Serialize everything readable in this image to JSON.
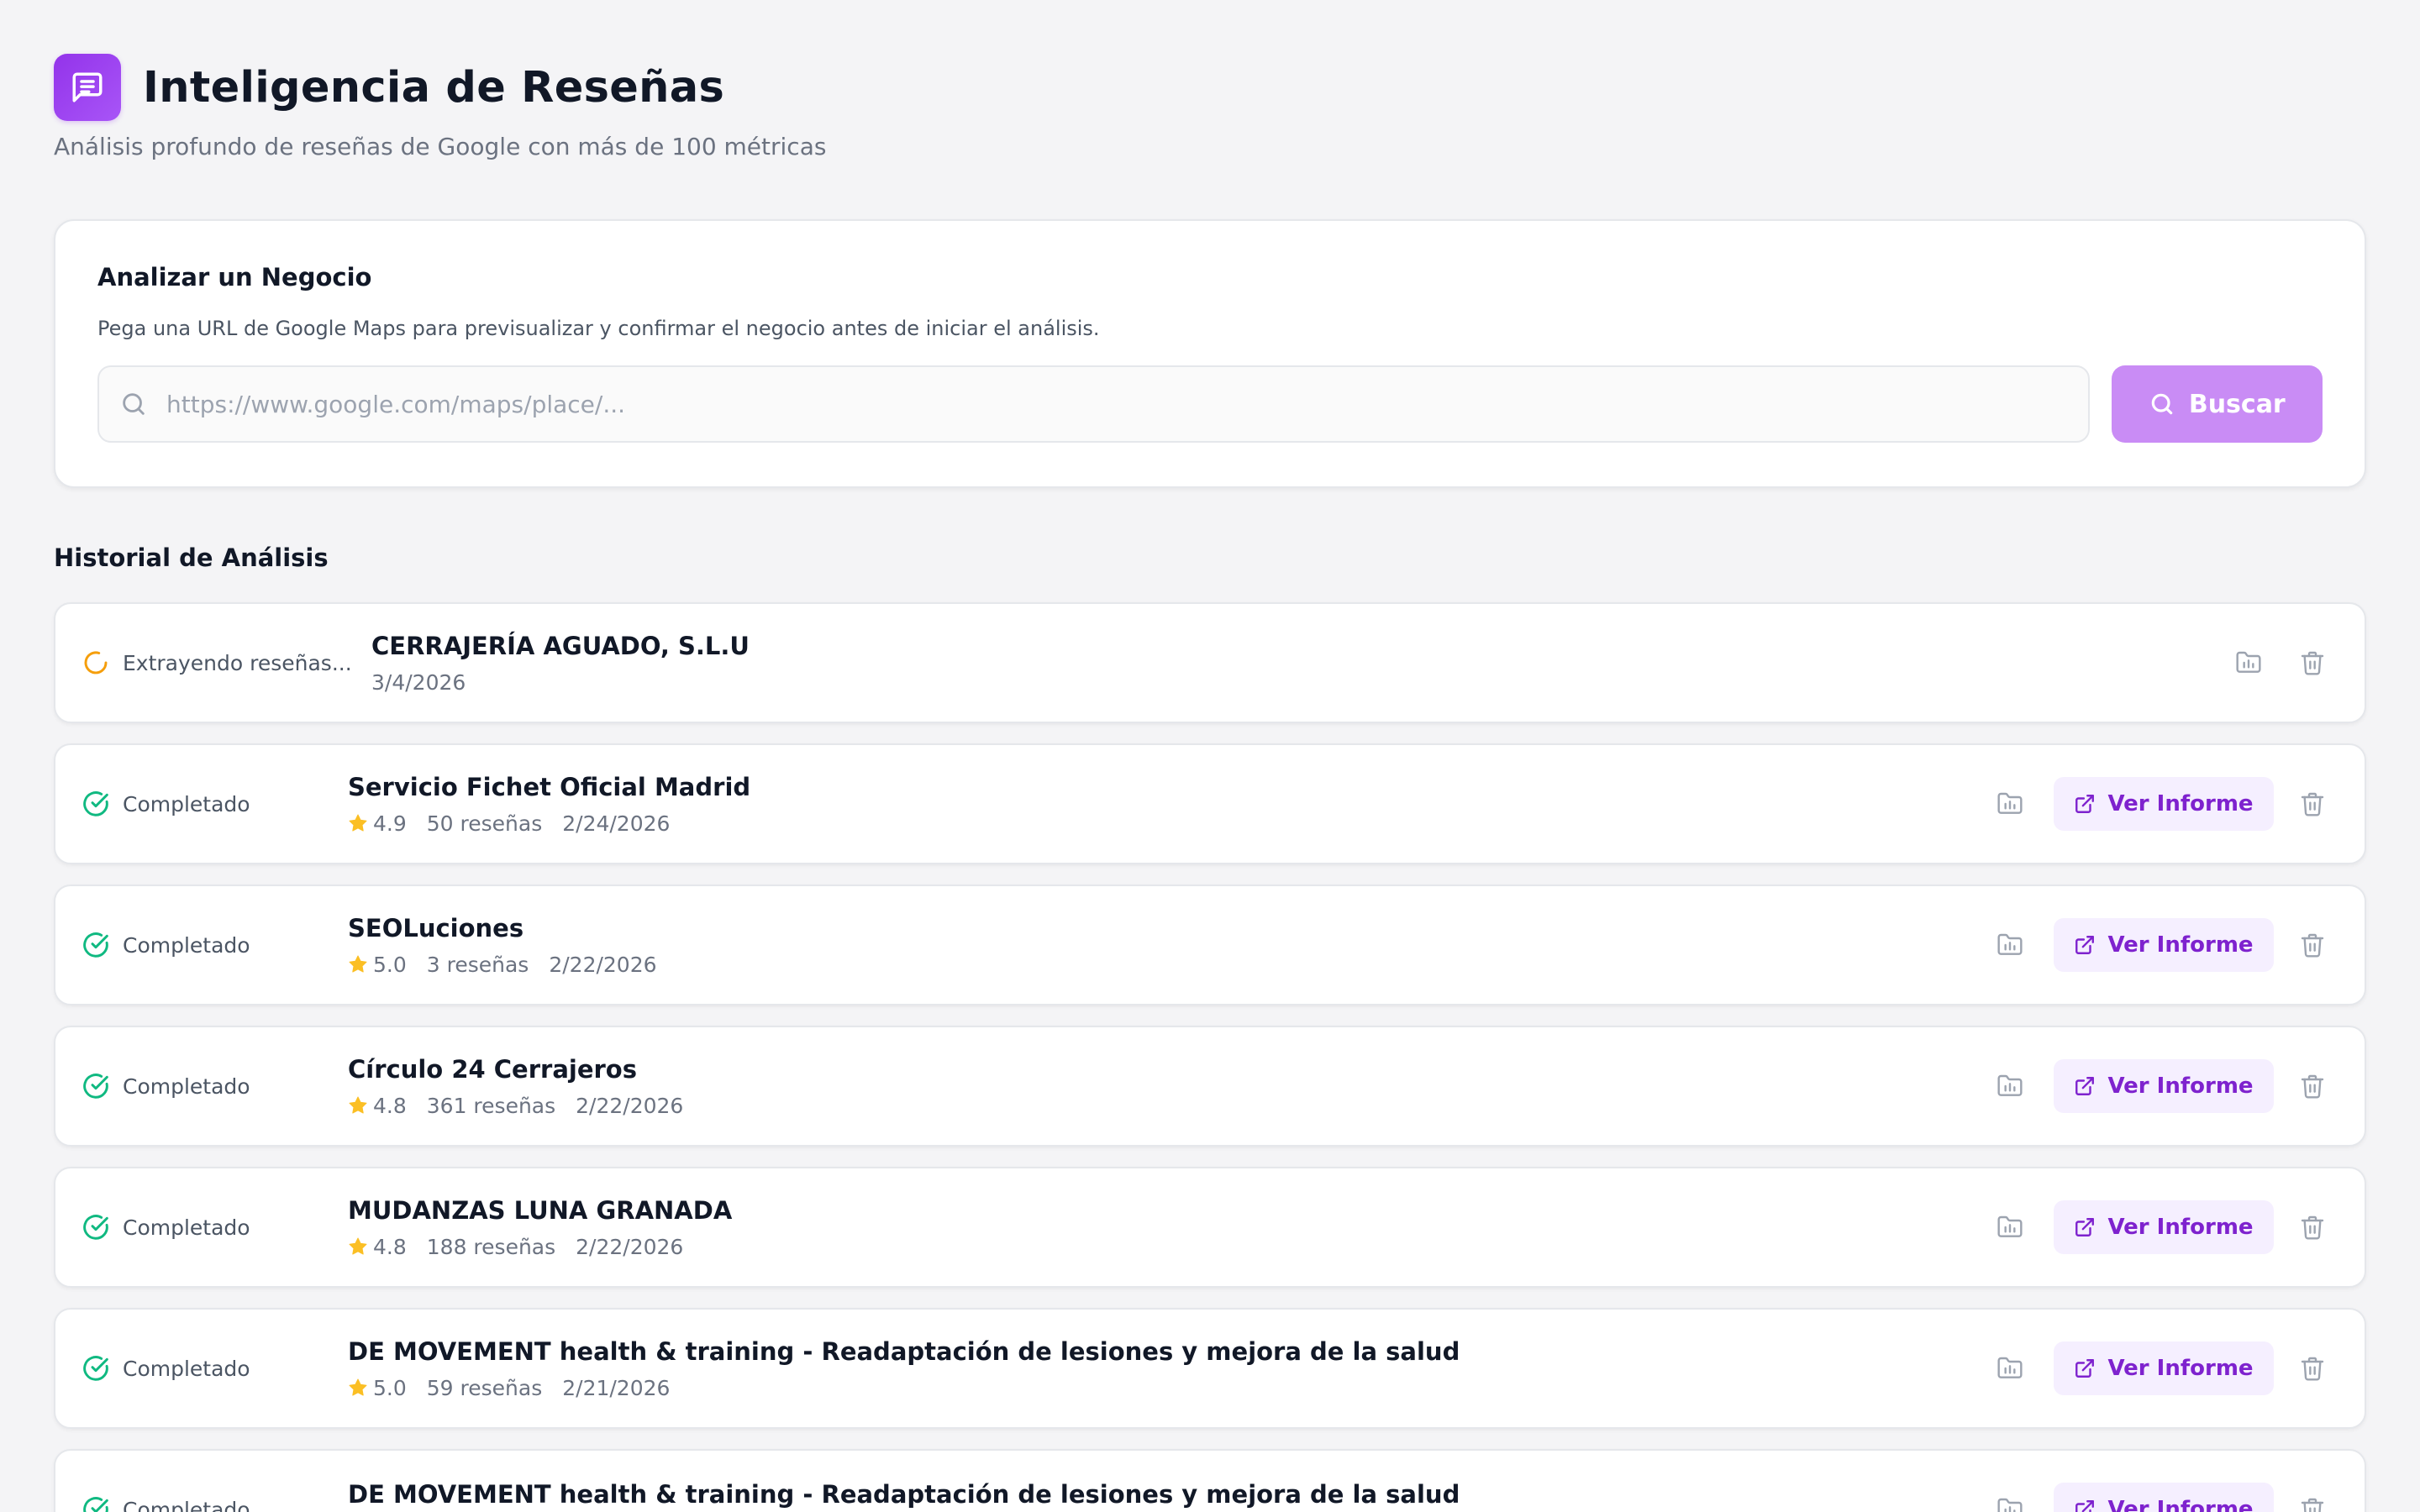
{
  "header": {
    "title": "Inteligencia de Reseñas",
    "subtitle": "Análisis profundo de reseñas de Google con más de 100 métricas"
  },
  "analyze": {
    "title": "Analizar un Negocio",
    "description": "Pega una URL de Google Maps para previsualizar y confirmar el negocio antes de iniciar el análisis.",
    "input_value": "",
    "placeholder": "https://www.google.com/maps/place/...",
    "search_label": "Buscar"
  },
  "history": {
    "title": "Historial de Análisis",
    "report_label": "Ver Informe",
    "items": [
      {
        "status": "extracting",
        "status_label": "Extrayendo reseñas...",
        "name": "CERRAJERÍA AGUADO, S.L.U",
        "date": "3/4/2026"
      },
      {
        "status": "completed",
        "status_label": "Completado",
        "name": "Servicio Fichet Oficial Madrid",
        "rating": "4.9",
        "reviews": "50 reseñas",
        "date": "2/24/2026"
      },
      {
        "status": "completed",
        "status_label": "Completado",
        "name": "SEOLuciones",
        "rating": "5.0",
        "reviews": "3 reseñas",
        "date": "2/22/2026"
      },
      {
        "status": "completed",
        "status_label": "Completado",
        "name": "Círculo 24 Cerrajeros",
        "rating": "4.8",
        "reviews": "361 reseñas",
        "date": "2/22/2026"
      },
      {
        "status": "completed",
        "status_label": "Completado",
        "name": "MUDANZAS LUNA GRANADA",
        "rating": "4.8",
        "reviews": "188 reseñas",
        "date": "2/22/2026"
      },
      {
        "status": "completed",
        "status_label": "Completado",
        "name": "DE MOVEMENT health & training - Readaptación de lesiones y mejora de la salud",
        "rating": "5.0",
        "reviews": "59 reseñas",
        "date": "2/21/2026"
      },
      {
        "status": "completed",
        "status_label": "Completado",
        "name": "DE MOVEMENT health & training - Readaptación de lesiones y mejora de la salud",
        "rating": "",
        "reviews": "",
        "date": ""
      }
    ]
  },
  "icons": {
    "logo": "message-square-text-icon",
    "search": "search-icon",
    "spinner": "loader-icon",
    "completed": "check-circle-icon",
    "star": "star-icon",
    "folder": "folder-chart-icon",
    "external": "external-link-icon",
    "delete": "trash-icon"
  },
  "colors": {
    "brand": "#9333ea",
    "search_button": "#c98cf5",
    "report_text": "#7e22ce",
    "report_bg": "#f5efff",
    "completed": "#10b981",
    "extracting": "#f59e0b",
    "star": "#fbbf24"
  }
}
